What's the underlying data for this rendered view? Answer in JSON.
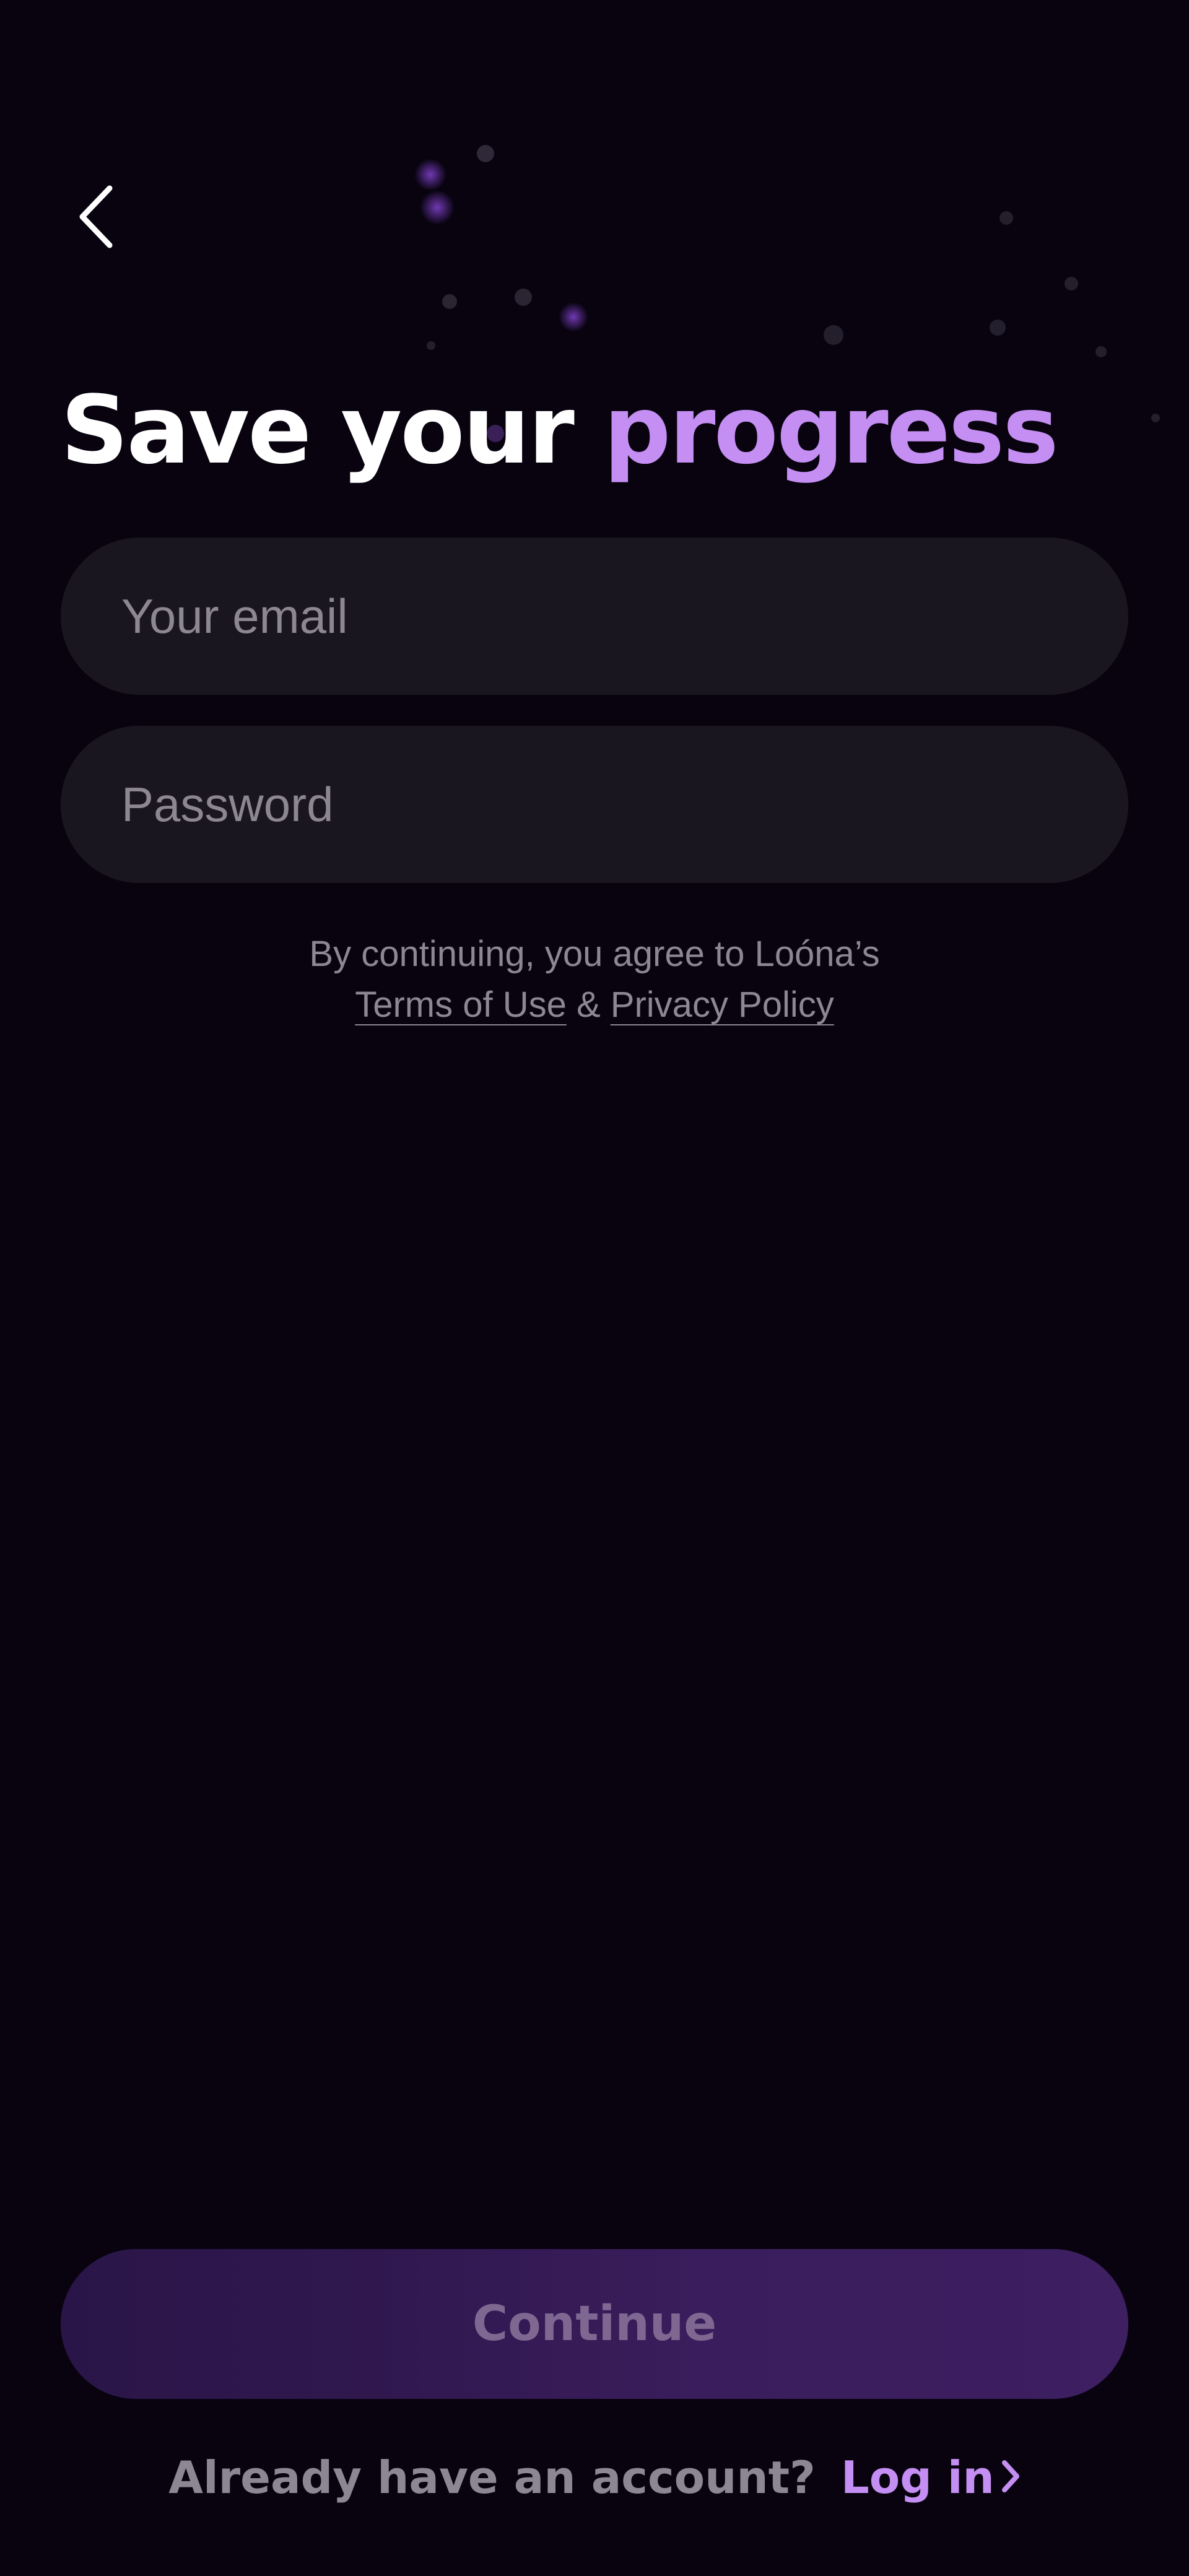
{
  "header": {
    "back_icon": "chevron-left-icon"
  },
  "title": {
    "text_plain": "Save your ",
    "text_accent": "progress"
  },
  "form": {
    "email_placeholder": "Your email",
    "email_value": "",
    "password_placeholder": "Password",
    "password_value": ""
  },
  "legal": {
    "intro": "By continuing, you agree to Loóna’s",
    "terms_link": "Terms of Use",
    "separator": "&",
    "privacy_link": "Privacy Policy"
  },
  "footer": {
    "continue_label": "Continue",
    "continue_enabled": false,
    "account_prompt": "Already have an account?",
    "login_link": "Log in",
    "login_icon": "chevron-right-icon"
  },
  "colors": {
    "background": "#08030f",
    "accent": "#c48ef2",
    "field_background": "#1a1620",
    "muted_text": "#8d8794",
    "button_background": "#30184f"
  }
}
